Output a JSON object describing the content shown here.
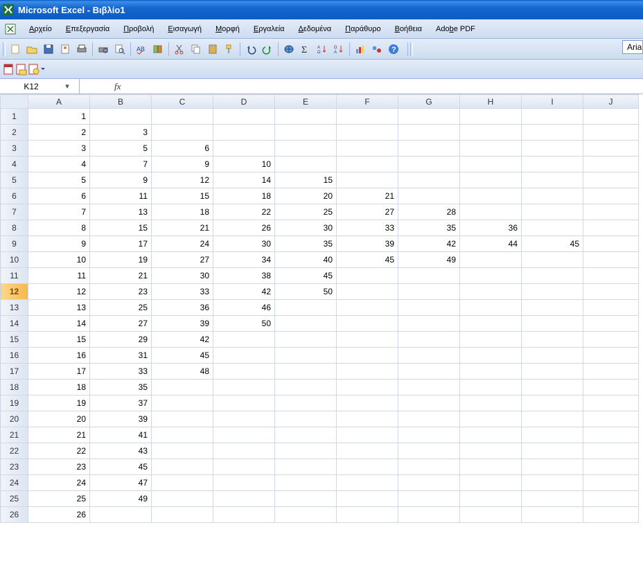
{
  "titlebar": {
    "title": "Microsoft Excel - Βιβλίο1"
  },
  "menubar": {
    "items": [
      {
        "accel": "Α",
        "label": "ρχείο"
      },
      {
        "accel": "Ε",
        "label": "πεξεργασία"
      },
      {
        "accel": "Π",
        "label": "ροβολή"
      },
      {
        "accel": "Ε",
        "label": "ισαγωγή"
      },
      {
        "accel": "Μ",
        "label": "ορφή"
      },
      {
        "accel": "Ε",
        "label": "ργαλεία"
      },
      {
        "accel": "Δ",
        "label": "εδομένα"
      },
      {
        "accel": "Π",
        "label": "αράθυρο"
      },
      {
        "accel": "Β",
        "label": "οήθεια"
      },
      {
        "accel": "",
        "label": "Adobe PDF",
        "pre": "Ado",
        "accel2": "b",
        "post": "e PDF"
      }
    ]
  },
  "formulabar": {
    "namebox": "K12",
    "fx": "fx"
  },
  "font_name": "Aria",
  "grid": {
    "columns": [
      "A",
      "B",
      "C",
      "D",
      "E",
      "F",
      "G",
      "H",
      "I",
      "J"
    ],
    "selected_row": 12,
    "rows": [
      {
        "n": 1,
        "cells": [
          "1",
          "",
          "",
          "",
          "",
          "",
          "",
          "",
          "",
          ""
        ]
      },
      {
        "n": 2,
        "cells": [
          "2",
          "3",
          "",
          "",
          "",
          "",
          "",
          "",
          "",
          ""
        ]
      },
      {
        "n": 3,
        "cells": [
          "3",
          "5",
          "6",
          "",
          "",
          "",
          "",
          "",
          "",
          ""
        ]
      },
      {
        "n": 4,
        "cells": [
          "4",
          "7",
          "9",
          "10",
          "",
          "",
          "",
          "",
          "",
          ""
        ]
      },
      {
        "n": 5,
        "cells": [
          "5",
          "9",
          "12",
          "14",
          "15",
          "",
          "",
          "",
          "",
          ""
        ]
      },
      {
        "n": 6,
        "cells": [
          "6",
          "11",
          "15",
          "18",
          "20",
          "21",
          "",
          "",
          "",
          ""
        ]
      },
      {
        "n": 7,
        "cells": [
          "7",
          "13",
          "18",
          "22",
          "25",
          "27",
          "28",
          "",
          "",
          ""
        ]
      },
      {
        "n": 8,
        "cells": [
          "8",
          "15",
          "21",
          "26",
          "30",
          "33",
          "35",
          "36",
          "",
          ""
        ]
      },
      {
        "n": 9,
        "cells": [
          "9",
          "17",
          "24",
          "30",
          "35",
          "39",
          "42",
          "44",
          "45",
          ""
        ]
      },
      {
        "n": 10,
        "cells": [
          "10",
          "19",
          "27",
          "34",
          "40",
          "45",
          "49",
          "",
          "",
          ""
        ]
      },
      {
        "n": 11,
        "cells": [
          "11",
          "21",
          "30",
          "38",
          "45",
          "",
          "",
          "",
          "",
          ""
        ]
      },
      {
        "n": 12,
        "cells": [
          "12",
          "23",
          "33",
          "42",
          "50",
          "",
          "",
          "",
          "",
          ""
        ]
      },
      {
        "n": 13,
        "cells": [
          "13",
          "25",
          "36",
          "46",
          "",
          "",
          "",
          "",
          "",
          ""
        ]
      },
      {
        "n": 14,
        "cells": [
          "14",
          "27",
          "39",
          "50",
          "",
          "",
          "",
          "",
          "",
          ""
        ]
      },
      {
        "n": 15,
        "cells": [
          "15",
          "29",
          "42",
          "",
          "",
          "",
          "",
          "",
          "",
          ""
        ]
      },
      {
        "n": 16,
        "cells": [
          "16",
          "31",
          "45",
          "",
          "",
          "",
          "",
          "",
          "",
          ""
        ]
      },
      {
        "n": 17,
        "cells": [
          "17",
          "33",
          "48",
          "",
          "",
          "",
          "",
          "",
          "",
          ""
        ]
      },
      {
        "n": 18,
        "cells": [
          "18",
          "35",
          "",
          "",
          "",
          "",
          "",
          "",
          "",
          ""
        ]
      },
      {
        "n": 19,
        "cells": [
          "19",
          "37",
          "",
          "",
          "",
          "",
          "",
          "",
          "",
          ""
        ]
      },
      {
        "n": 20,
        "cells": [
          "20",
          "39",
          "",
          "",
          "",
          "",
          "",
          "",
          "",
          ""
        ]
      },
      {
        "n": 21,
        "cells": [
          "21",
          "41",
          "",
          "",
          "",
          "",
          "",
          "",
          "",
          ""
        ]
      },
      {
        "n": 22,
        "cells": [
          "22",
          "43",
          "",
          "",
          "",
          "",
          "",
          "",
          "",
          ""
        ]
      },
      {
        "n": 23,
        "cells": [
          "23",
          "45",
          "",
          "",
          "",
          "",
          "",
          "",
          "",
          ""
        ]
      },
      {
        "n": 24,
        "cells": [
          "24",
          "47",
          "",
          "",
          "",
          "",
          "",
          "",
          "",
          ""
        ]
      },
      {
        "n": 25,
        "cells": [
          "25",
          "49",
          "",
          "",
          "",
          "",
          "",
          "",
          "",
          ""
        ]
      },
      {
        "n": 26,
        "cells": [
          "26",
          "",
          "",
          "",
          "",
          "",
          "",
          "",
          "",
          ""
        ]
      }
    ]
  },
  "chart_data": {
    "type": "table",
    "note": "Spreadsheet cell grid; numbers shown are cell values by row/column.",
    "columns": [
      "A",
      "B",
      "C",
      "D",
      "E",
      "F",
      "G",
      "H",
      "I"
    ],
    "rows": [
      [
        1
      ],
      [
        2,
        3
      ],
      [
        3,
        5,
        6
      ],
      [
        4,
        7,
        9,
        10
      ],
      [
        5,
        9,
        12,
        14,
        15
      ],
      [
        6,
        11,
        15,
        18,
        20,
        21
      ],
      [
        7,
        13,
        18,
        22,
        25,
        27,
        28
      ],
      [
        8,
        15,
        21,
        26,
        30,
        33,
        35,
        36
      ],
      [
        9,
        17,
        24,
        30,
        35,
        39,
        42,
        44,
        45
      ],
      [
        10,
        19,
        27,
        34,
        40,
        45,
        49
      ],
      [
        11,
        21,
        30,
        38,
        45
      ],
      [
        12,
        23,
        33,
        42,
        50
      ],
      [
        13,
        25,
        36,
        46
      ],
      [
        14,
        27,
        39,
        50
      ],
      [
        15,
        29,
        42
      ],
      [
        16,
        31,
        45
      ],
      [
        17,
        33,
        48
      ],
      [
        18,
        35
      ],
      [
        19,
        37
      ],
      [
        20,
        39
      ],
      [
        21,
        41
      ],
      [
        22,
        43
      ],
      [
        23,
        45
      ],
      [
        24,
        47
      ],
      [
        25,
        49
      ],
      [
        26
      ]
    ]
  }
}
